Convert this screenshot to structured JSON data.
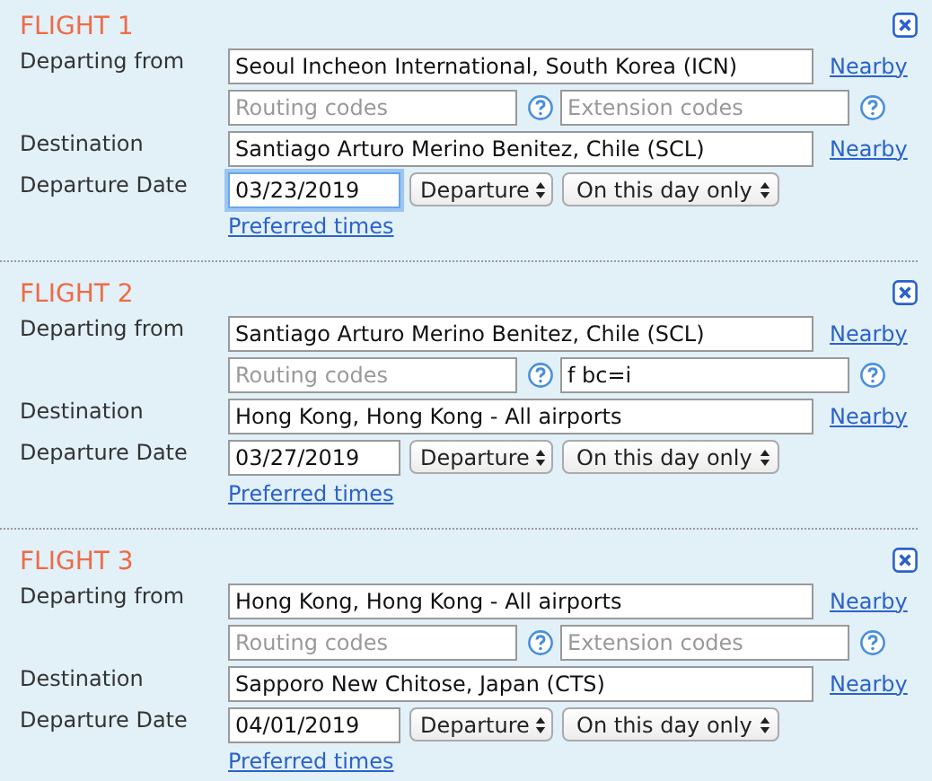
{
  "flights": [
    {
      "title": "FLIGHT 1",
      "labels": {
        "departing": "Departing from",
        "destination": "Destination",
        "date": "Departure Date"
      },
      "departing": {
        "value": "Seoul Incheon International, South Korea (ICN)"
      },
      "departing_link": "Nearby",
      "routing": {
        "placeholder": "Routing codes"
      },
      "extension": {
        "placeholder": "Extension codes"
      },
      "destination": {
        "value": "Santiago Arturo Merino Benitez, Chile (SCL)"
      },
      "destination_link": "Nearby",
      "date": {
        "value": "03/23/2019",
        "focused": true
      },
      "time_type": "Departure",
      "range": "On this day only",
      "preferred_link": "Preferred times"
    },
    {
      "title": "FLIGHT 2",
      "labels": {
        "departing": "Departing from",
        "destination": "Destination",
        "date": "Departure Date"
      },
      "departing": {
        "value": "Santiago Arturo Merino Benitez, Chile (SCL)"
      },
      "departing_link": "Nearby",
      "routing": {
        "placeholder": "Routing codes"
      },
      "extension": {
        "value": "f bc=i"
      },
      "destination": {
        "value": "Hong Kong, Hong Kong - All airports"
      },
      "destination_link": "Nearby",
      "date": {
        "value": "03/27/2019",
        "focused": false
      },
      "time_type": "Departure",
      "range": "On this day only",
      "preferred_link": "Preferred times"
    },
    {
      "title": "FLIGHT 3",
      "labels": {
        "departing": "Departing from",
        "destination": "Destination",
        "date": "Departure Date"
      },
      "departing": {
        "value": "Hong Kong, Hong Kong - All airports"
      },
      "departing_link": "Nearby",
      "routing": {
        "placeholder": "Routing codes"
      },
      "extension": {
        "placeholder": "Extension codes"
      },
      "destination": {
        "value": "Sapporo New Chitose, Japan (CTS)"
      },
      "destination_link": "Nearby",
      "date": {
        "value": "04/01/2019",
        "focused": false
      },
      "time_type": "Departure",
      "range": "On this day only",
      "preferred_link": "Preferred times"
    }
  ]
}
